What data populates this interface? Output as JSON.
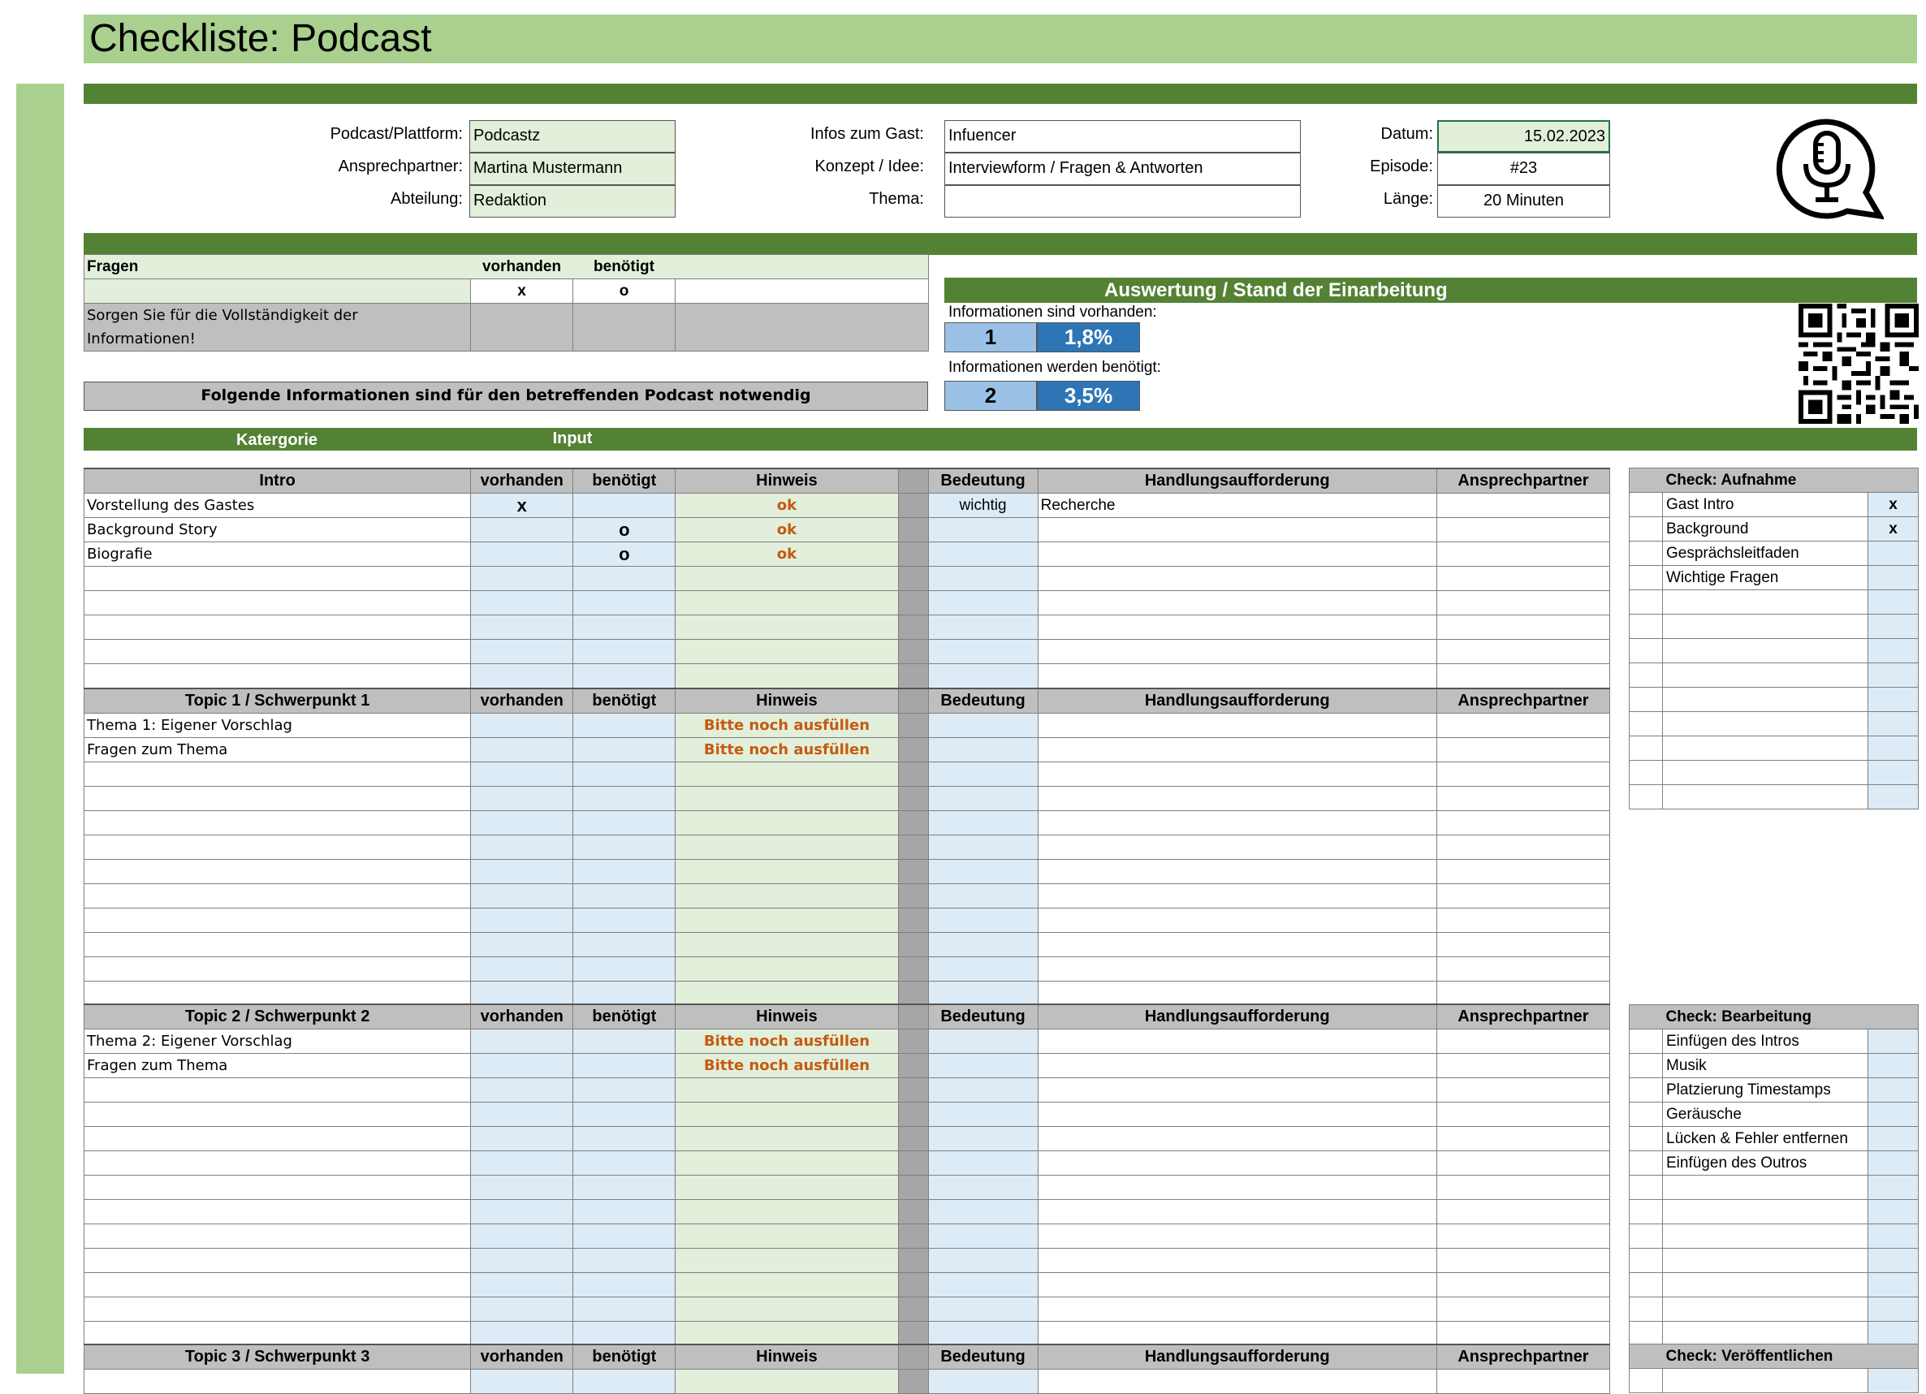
{
  "title": "Checkliste: Podcast",
  "info": {
    "podcast_label": "Podcast/Plattform:",
    "podcast_value": "Podcastz",
    "contact_label": "Ansprechpartner:",
    "contact_value": "Martina Mustermann",
    "dept_label": "Abteilung:",
    "dept_value": "Redaktion",
    "guest_label": "Infos zum Gast:",
    "guest_value": "Infuencer",
    "concept_label": "Konzept / Idee:",
    "concept_value": "Interviewform / Fragen & Antworten",
    "topic_label": "Thema:",
    "topic_value": "",
    "date_label": "Datum:",
    "date_value": "15.02.2023",
    "episode_label": "Episode:",
    "episode_value": "#23",
    "length_label": "Länge:",
    "length_value": "20 Minuten"
  },
  "fragen": {
    "title": "Fragen",
    "vorhanden": "vorhanden",
    "benoetigt": "benötigt",
    "x": "x",
    "o": "o",
    "note": "Sorgen Sie für die Vollständigkeit der Informationen!"
  },
  "notice": "Folgende Informationen sind für den betreffenden Podcast notwendig",
  "bar_labels": {
    "kategorie": "Katergorie",
    "input": "Input"
  },
  "auswertung": {
    "title": "Auswertung / Stand der Einarbeitung",
    "vorhanden_label": "Informationen sind vorhanden:",
    "vorhanden_count": "1",
    "vorhanden_pct": "1,8%",
    "benoetigt_label": "Informationen werden benötigt:",
    "benoetigt_count": "2",
    "benoetigt_pct": "3,5%"
  },
  "columns": {
    "vorhanden": "vorhanden",
    "benoetigt": "benötigt",
    "hinweis": "Hinweis",
    "bedeutung": "Bedeutung",
    "handlung": "Handlungsaufforderung",
    "ansprech": "Ansprechpartner"
  },
  "sections": [
    {
      "title": "Intro",
      "rows": [
        {
          "name": "Vorstellung des Gastes",
          "vorhanden": "x",
          "benoetigt": "",
          "hinweis": "ok",
          "bedeutung": "wichtig",
          "handlung": "Recherche"
        },
        {
          "name": "Background Story",
          "vorhanden": "",
          "benoetigt": "o",
          "hinweis": "ok",
          "bedeutung": "",
          "handlung": ""
        },
        {
          "name": "Biografie",
          "vorhanden": "",
          "benoetigt": "o",
          "hinweis": "ok",
          "bedeutung": "",
          "handlung": ""
        }
      ]
    },
    {
      "title": "Topic 1 / Schwerpunkt 1",
      "rows": [
        {
          "name": "Thema 1: Eigener Vorschlag",
          "vorhanden": "",
          "benoetigt": "",
          "hinweis": "Bitte noch ausfüllen",
          "bedeutung": "",
          "handlung": ""
        },
        {
          "name": "Fragen zum Thema",
          "vorhanden": "",
          "benoetigt": "",
          "hinweis": "Bitte noch ausfüllen",
          "bedeutung": "",
          "handlung": ""
        }
      ]
    },
    {
      "title": "Topic 2 / Schwerpunkt 2",
      "rows": [
        {
          "name": "Thema 2: Eigener Vorschlag",
          "vorhanden": "",
          "benoetigt": "",
          "hinweis": "Bitte noch ausfüllen",
          "bedeutung": "",
          "handlung": ""
        },
        {
          "name": "Fragen zum Thema",
          "vorhanden": "",
          "benoetigt": "",
          "hinweis": "Bitte noch ausfüllen",
          "bedeutung": "",
          "handlung": ""
        }
      ]
    },
    {
      "title": "Topic 3 / Schwerpunkt 3",
      "rows": []
    }
  ],
  "checks": [
    {
      "title": "Check: Aufnahme",
      "items": [
        {
          "label": "Gast Intro",
          "mark": "x"
        },
        {
          "label": "Background",
          "mark": "x"
        },
        {
          "label": "Gesprächsleitfaden",
          "mark": ""
        },
        {
          "label": "Wichtige Fragen",
          "mark": ""
        }
      ]
    },
    {
      "title": "Check: Bearbeitung",
      "items": [
        {
          "label": "Einfügen des Intros",
          "mark": ""
        },
        {
          "label": "Musik",
          "mark": ""
        },
        {
          "label": "Platzierung Timestamps",
          "mark": ""
        },
        {
          "label": "Geräusche",
          "mark": ""
        },
        {
          "label": "Lücken & Fehler entfernen",
          "mark": ""
        },
        {
          "label": "Einfügen des Outros",
          "mark": ""
        }
      ]
    },
    {
      "title": "Check: Veröffentlichen",
      "items": []
    }
  ],
  "icons": {
    "logo": "podcast-microphone-icon",
    "qr": "qr-code-icon"
  },
  "colors": {
    "light_green": "#a9d08e",
    "dark_green": "#548235",
    "blue": "#2e75b6",
    "light_blue": "#9bc2e6",
    "warn": "#c55a11"
  }
}
